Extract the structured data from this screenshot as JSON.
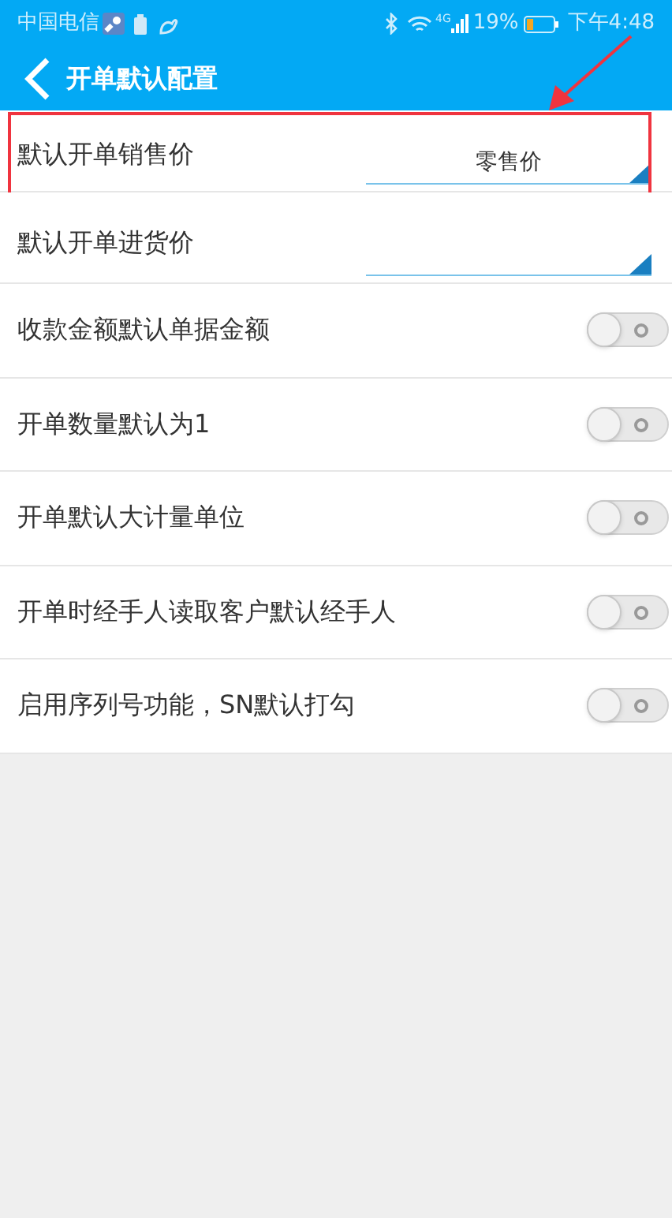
{
  "status_bar": {
    "carrier": "中国电信",
    "network": "4G",
    "battery": "19%",
    "time": "下午4:48"
  },
  "header": {
    "title": "开单默认配置"
  },
  "settings": [
    {
      "kind": "select",
      "label": "默认开单销售价",
      "value": "零售价",
      "highlighted": true
    },
    {
      "kind": "select",
      "label": "默认开单进货价",
      "highlighted": false
    },
    {
      "kind": "toggle",
      "label": "收款金额默认单据金额",
      "on": false
    },
    {
      "kind": "toggle",
      "label": "开单数量默认为1",
      "on": false
    },
    {
      "kind": "toggle",
      "label": "开单默认大计量单位",
      "on": false
    },
    {
      "kind": "toggle",
      "label": "开单时经手人读取客户默认经手人",
      "on": false
    },
    {
      "kind": "toggle",
      "label": "启用序列号功能，SN默认打勾",
      "on": false
    }
  ]
}
